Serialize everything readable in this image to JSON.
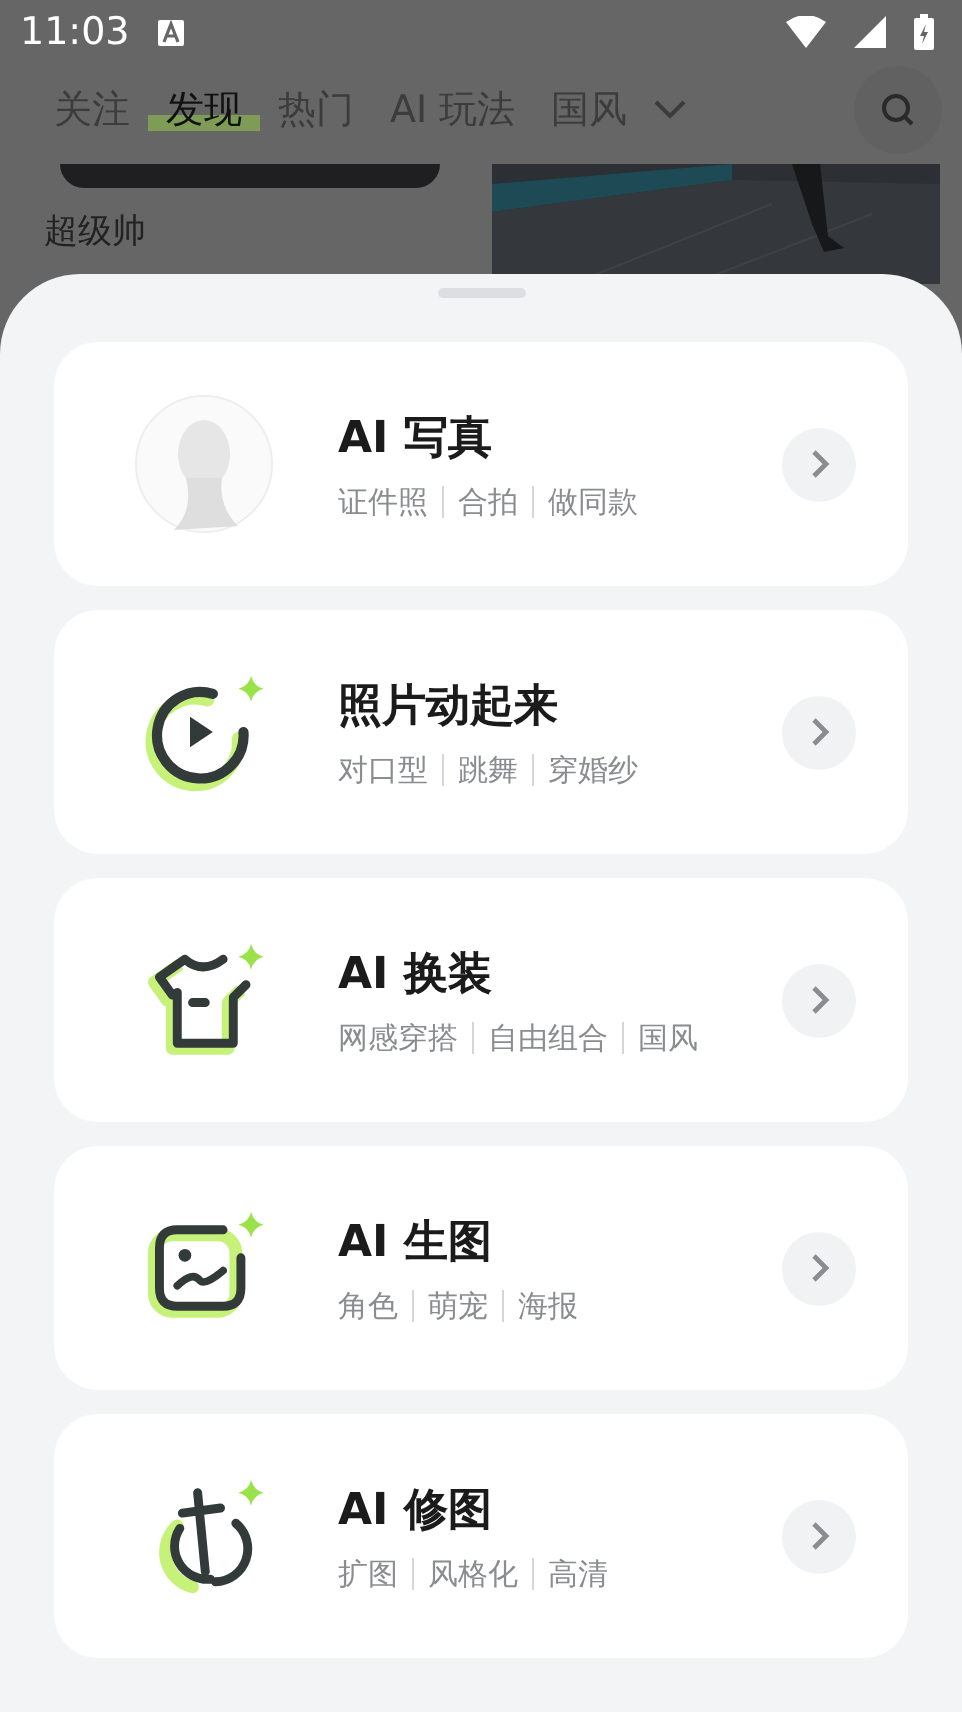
{
  "status_bar": {
    "time": "11:03"
  },
  "tabs": [
    {
      "label": "关注",
      "selected": false
    },
    {
      "label": "发现",
      "selected": true
    },
    {
      "label": "热门",
      "selected": false
    },
    {
      "label": "AI 玩法",
      "selected": false
    },
    {
      "label": "国风",
      "selected": false
    }
  ],
  "feed": {
    "caption": "超级帅"
  },
  "features": [
    {
      "kind": "portrait",
      "title": "AI 写真",
      "tags": [
        "证件照",
        "合拍",
        "做同款"
      ]
    },
    {
      "kind": "play",
      "title": "照片动起来",
      "tags": [
        "对口型",
        "跳舞",
        "穿婚纱"
      ]
    },
    {
      "kind": "shirt",
      "title": "AI 换装",
      "tags": [
        "网感穿搭",
        "自由组合",
        "国风"
      ]
    },
    {
      "kind": "frame",
      "title": "AI 生图",
      "tags": [
        "角色",
        "萌宠",
        "海报"
      ]
    },
    {
      "kind": "retouch",
      "title": "AI 修图",
      "tags": [
        "扩图",
        "风格化",
        "高清"
      ]
    }
  ]
}
